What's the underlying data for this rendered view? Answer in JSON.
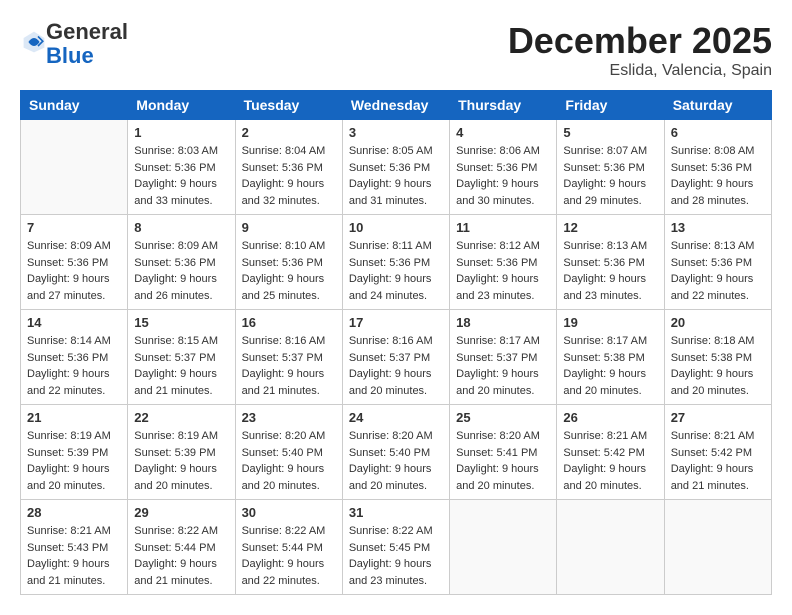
{
  "header": {
    "logo": {
      "general": "General",
      "blue": "Blue",
      "tagline": "General Blue"
    },
    "title": "December 2025",
    "location": "Eslida, Valencia, Spain"
  },
  "days_of_week": [
    "Sunday",
    "Monday",
    "Tuesday",
    "Wednesday",
    "Thursday",
    "Friday",
    "Saturday"
  ],
  "weeks": [
    [
      {
        "day": "",
        "sunrise": "",
        "sunset": "",
        "daylight": ""
      },
      {
        "day": "1",
        "sunrise": "Sunrise: 8:03 AM",
        "sunset": "Sunset: 5:36 PM",
        "daylight": "Daylight: 9 hours and 33 minutes."
      },
      {
        "day": "2",
        "sunrise": "Sunrise: 8:04 AM",
        "sunset": "Sunset: 5:36 PM",
        "daylight": "Daylight: 9 hours and 32 minutes."
      },
      {
        "day": "3",
        "sunrise": "Sunrise: 8:05 AM",
        "sunset": "Sunset: 5:36 PM",
        "daylight": "Daylight: 9 hours and 31 minutes."
      },
      {
        "day": "4",
        "sunrise": "Sunrise: 8:06 AM",
        "sunset": "Sunset: 5:36 PM",
        "daylight": "Daylight: 9 hours and 30 minutes."
      },
      {
        "day": "5",
        "sunrise": "Sunrise: 8:07 AM",
        "sunset": "Sunset: 5:36 PM",
        "daylight": "Daylight: 9 hours and 29 minutes."
      },
      {
        "day": "6",
        "sunrise": "Sunrise: 8:08 AM",
        "sunset": "Sunset: 5:36 PM",
        "daylight": "Daylight: 9 hours and 28 minutes."
      }
    ],
    [
      {
        "day": "7",
        "sunrise": "Sunrise: 8:09 AM",
        "sunset": "Sunset: 5:36 PM",
        "daylight": "Daylight: 9 hours and 27 minutes."
      },
      {
        "day": "8",
        "sunrise": "Sunrise: 8:09 AM",
        "sunset": "Sunset: 5:36 PM",
        "daylight": "Daylight: 9 hours and 26 minutes."
      },
      {
        "day": "9",
        "sunrise": "Sunrise: 8:10 AM",
        "sunset": "Sunset: 5:36 PM",
        "daylight": "Daylight: 9 hours and 25 minutes."
      },
      {
        "day": "10",
        "sunrise": "Sunrise: 8:11 AM",
        "sunset": "Sunset: 5:36 PM",
        "daylight": "Daylight: 9 hours and 24 minutes."
      },
      {
        "day": "11",
        "sunrise": "Sunrise: 8:12 AM",
        "sunset": "Sunset: 5:36 PM",
        "daylight": "Daylight: 9 hours and 23 minutes."
      },
      {
        "day": "12",
        "sunrise": "Sunrise: 8:13 AM",
        "sunset": "Sunset: 5:36 PM",
        "daylight": "Daylight: 9 hours and 23 minutes."
      },
      {
        "day": "13",
        "sunrise": "Sunrise: 8:13 AM",
        "sunset": "Sunset: 5:36 PM",
        "daylight": "Daylight: 9 hours and 22 minutes."
      }
    ],
    [
      {
        "day": "14",
        "sunrise": "Sunrise: 8:14 AM",
        "sunset": "Sunset: 5:36 PM",
        "daylight": "Daylight: 9 hours and 22 minutes."
      },
      {
        "day": "15",
        "sunrise": "Sunrise: 8:15 AM",
        "sunset": "Sunset: 5:37 PM",
        "daylight": "Daylight: 9 hours and 21 minutes."
      },
      {
        "day": "16",
        "sunrise": "Sunrise: 8:16 AM",
        "sunset": "Sunset: 5:37 PM",
        "daylight": "Daylight: 9 hours and 21 minutes."
      },
      {
        "day": "17",
        "sunrise": "Sunrise: 8:16 AM",
        "sunset": "Sunset: 5:37 PM",
        "daylight": "Daylight: 9 hours and 20 minutes."
      },
      {
        "day": "18",
        "sunrise": "Sunrise: 8:17 AM",
        "sunset": "Sunset: 5:37 PM",
        "daylight": "Daylight: 9 hours and 20 minutes."
      },
      {
        "day": "19",
        "sunrise": "Sunrise: 8:17 AM",
        "sunset": "Sunset: 5:38 PM",
        "daylight": "Daylight: 9 hours and 20 minutes."
      },
      {
        "day": "20",
        "sunrise": "Sunrise: 8:18 AM",
        "sunset": "Sunset: 5:38 PM",
        "daylight": "Daylight: 9 hours and 20 minutes."
      }
    ],
    [
      {
        "day": "21",
        "sunrise": "Sunrise: 8:19 AM",
        "sunset": "Sunset: 5:39 PM",
        "daylight": "Daylight: 9 hours and 20 minutes."
      },
      {
        "day": "22",
        "sunrise": "Sunrise: 8:19 AM",
        "sunset": "Sunset: 5:39 PM",
        "daylight": "Daylight: 9 hours and 20 minutes."
      },
      {
        "day": "23",
        "sunrise": "Sunrise: 8:20 AM",
        "sunset": "Sunset: 5:40 PM",
        "daylight": "Daylight: 9 hours and 20 minutes."
      },
      {
        "day": "24",
        "sunrise": "Sunrise: 8:20 AM",
        "sunset": "Sunset: 5:40 PM",
        "daylight": "Daylight: 9 hours and 20 minutes."
      },
      {
        "day": "25",
        "sunrise": "Sunrise: 8:20 AM",
        "sunset": "Sunset: 5:41 PM",
        "daylight": "Daylight: 9 hours and 20 minutes."
      },
      {
        "day": "26",
        "sunrise": "Sunrise: 8:21 AM",
        "sunset": "Sunset: 5:42 PM",
        "daylight": "Daylight: 9 hours and 20 minutes."
      },
      {
        "day": "27",
        "sunrise": "Sunrise: 8:21 AM",
        "sunset": "Sunset: 5:42 PM",
        "daylight": "Daylight: 9 hours and 21 minutes."
      }
    ],
    [
      {
        "day": "28",
        "sunrise": "Sunrise: 8:21 AM",
        "sunset": "Sunset: 5:43 PM",
        "daylight": "Daylight: 9 hours and 21 minutes."
      },
      {
        "day": "29",
        "sunrise": "Sunrise: 8:22 AM",
        "sunset": "Sunset: 5:44 PM",
        "daylight": "Daylight: 9 hours and 21 minutes."
      },
      {
        "day": "30",
        "sunrise": "Sunrise: 8:22 AM",
        "sunset": "Sunset: 5:44 PM",
        "daylight": "Daylight: 9 hours and 22 minutes."
      },
      {
        "day": "31",
        "sunrise": "Sunrise: 8:22 AM",
        "sunset": "Sunset: 5:45 PM",
        "daylight": "Daylight: 9 hours and 23 minutes."
      },
      {
        "day": "",
        "sunrise": "",
        "sunset": "",
        "daylight": ""
      },
      {
        "day": "",
        "sunrise": "",
        "sunset": "",
        "daylight": ""
      },
      {
        "day": "",
        "sunrise": "",
        "sunset": "",
        "daylight": ""
      }
    ]
  ]
}
